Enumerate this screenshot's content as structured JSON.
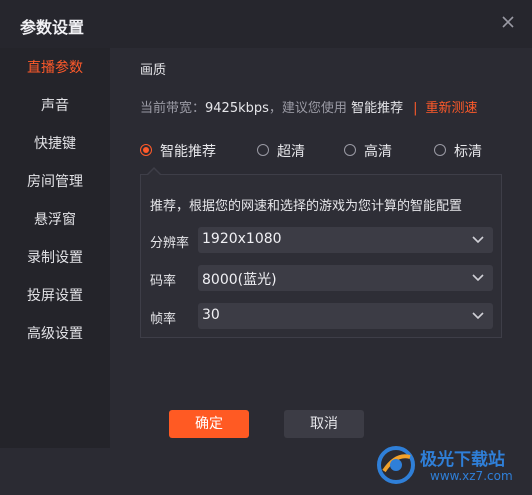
{
  "window": {
    "title": "参数设置",
    "close_icon": "close-icon"
  },
  "sidebar": {
    "items": [
      {
        "label": "直播参数",
        "active": true
      },
      {
        "label": "声音"
      },
      {
        "label": "快捷键"
      },
      {
        "label": "房间管理"
      },
      {
        "label": "悬浮窗"
      },
      {
        "label": "录制设置"
      },
      {
        "label": "投屏设置"
      },
      {
        "label": "高级设置"
      }
    ]
  },
  "main": {
    "section_title": "画质",
    "bandwidth": {
      "prefix": "当前带宽：",
      "value": "9425kbps",
      "suggest": "，建议您使用",
      "recommended": "智能推荐",
      "separator": "|",
      "retest": "重新测速"
    },
    "quality_options": [
      {
        "label": "智能推荐",
        "selected": true
      },
      {
        "label": "超清"
      },
      {
        "label": "高清"
      },
      {
        "label": "标清"
      }
    ],
    "panel": {
      "description": "推荐，根据您的网速和选择的游戏为您计算的智能配置",
      "resolution": {
        "label": "分辨率",
        "value": "1920x1080"
      },
      "bitrate": {
        "label": "码率",
        "value": "8000(蓝光)"
      },
      "framerate": {
        "label": "帧率",
        "value": "30"
      }
    }
  },
  "footer": {
    "confirm": "确定",
    "cancel": "取消"
  },
  "watermark": {
    "name": "极光下载站",
    "url": "www.xz7.com"
  },
  "colors": {
    "accent": "#ff5a23",
    "background": "#2b2b33",
    "sidebar": "#24242a",
    "watermark": "#2f7fd8"
  }
}
